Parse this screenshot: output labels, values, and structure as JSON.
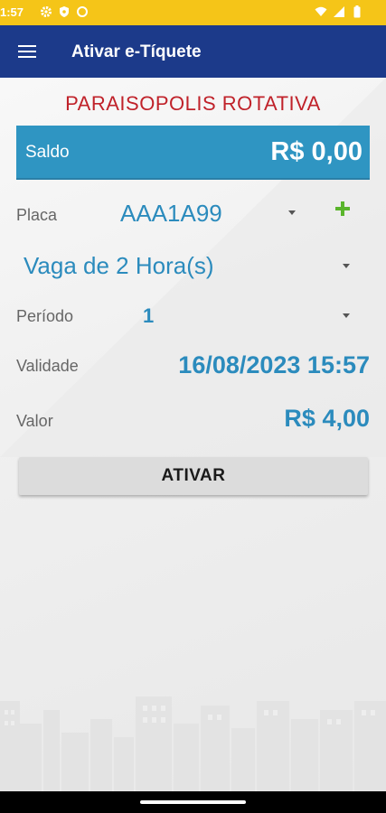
{
  "status_bar": {
    "time": "1:57",
    "icons": [
      "gear-icon",
      "shield-icon",
      "circle-icon",
      "wifi-icon",
      "signal-icon",
      "battery-icon"
    ]
  },
  "app_bar": {
    "menu_icon": "hamburger-menu-icon",
    "title": "Ativar e-Tíquete"
  },
  "main": {
    "org_title": "PARAISOPOLIS ROTATIVA",
    "saldo": {
      "label": "Saldo",
      "value": "R$ 0,00"
    },
    "placa": {
      "label": "Placa",
      "value": "AAA1A99",
      "add_icon": "plus-icon"
    },
    "vaga": {
      "value": "Vaga de 2 Hora(s)"
    },
    "periodo": {
      "label": "Período",
      "value": "1"
    },
    "validade": {
      "label": "Validade",
      "value": "16/08/2023 15:57"
    },
    "valor": {
      "label": "Valor",
      "value": "R$ 4,00"
    },
    "ativar_button": "ATIVAR"
  },
  "colors": {
    "status_bar": "#f5c518",
    "app_bar": "#1c3a8a",
    "org_title": "#c0222a",
    "saldo_bg": "#2f95c2",
    "value_blue": "#2b8bbd",
    "plus_green": "#5ab52c"
  }
}
